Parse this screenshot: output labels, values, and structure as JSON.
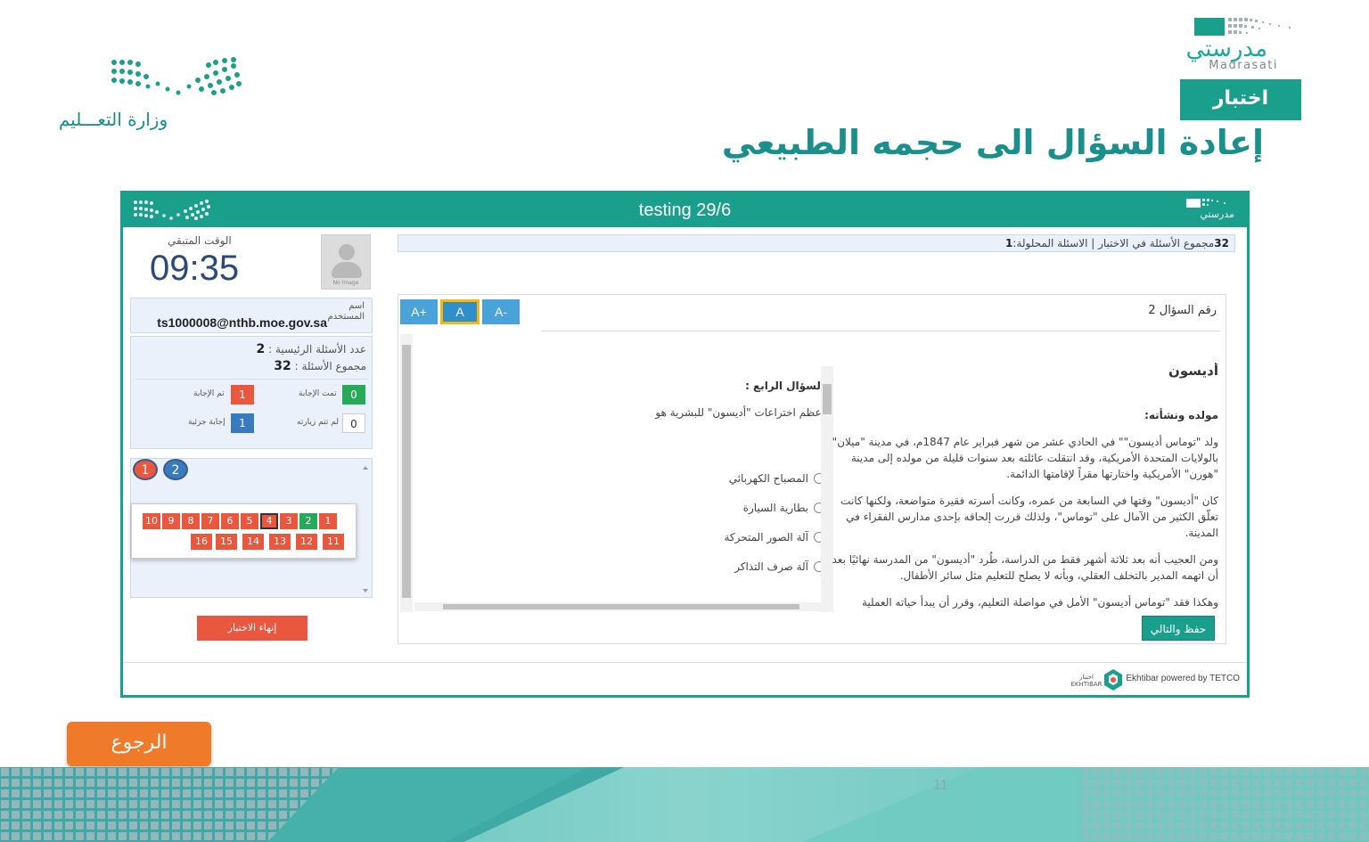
{
  "slide": {
    "moe_logo_text": "وزارة التعـــليم",
    "madrasati_ar": "مدرستي",
    "madrasati_en": "Madrasati",
    "exam_tag": "اختبار",
    "title": "إعادة السؤال الى حجمه الطبيعي",
    "back_button": "الرجوع",
    "page_number": "11"
  },
  "app": {
    "title": "testing 29/6",
    "header_logo_text": "مدرستي",
    "timer_label": "الوقت المتبقي",
    "timer": "09:35",
    "avatar_caption": "No Image",
    "user_label": "اسم المستخدم",
    "user_value": "ts1000008@nthb.moe.gov.sa",
    "main_questions_label": "عدد الأسئلة الرئيسية :",
    "main_questions_value": "2",
    "total_questions_label": "مجموع الأسئلة :",
    "total_questions_value": "32",
    "legend": {
      "completed_count": "0",
      "completed_label": "تمت الإجابة",
      "answered_count": "1",
      "answered_label": "تم الإجابة",
      "unvisited_count": "0",
      "unvisited_label": "لم تتم زيارته",
      "partial_count": "1",
      "partial_label": "إجابة جزئية"
    },
    "main_question_circles": [
      "1",
      "2"
    ],
    "sub_questions_row1": [
      "10",
      "9",
      "8",
      "7",
      "6",
      "5",
      "4",
      "3",
      "2",
      "1"
    ],
    "sub_questions_row2": [
      "16",
      "15",
      "14",
      "13",
      "12",
      "11"
    ],
    "end_exam_button": "إنهاء الاختبار",
    "summary_total": "32",
    "summary_text": "مجموع الأسئلة في الاختبار | الاسئلة المحلولة:",
    "summary_solved": "1",
    "font_buttons": {
      "increase": "A+",
      "normal": "A",
      "decrease": "A-"
    },
    "question_number": "رقم السؤال 2",
    "passage": {
      "title": "أديسون",
      "subtitle": "مولده ونشأته:",
      "p1": "ولد \"توماس أديسون\"\" في الحادي عشر من شهر فبراير عام 1847م، في مدينة \"ميلان\" بالولايات المتحدة الأمريكية، وقد انتقلت عائلته بعد سنوات قليلة من مولده إلى مدينة \"هورن\" الأمريكية واختارتها مقراً لإقامتها الدائمة.",
      "p2": "كان \"أديسون\" وقتها في السابعة من عمره، وكانت أسرته فقيرة متواضعة، ولكنها كانت تعلّق الكثير من الآمال على \"توماس\"، ولذلك قررت إلحاقه بإحدى مدارس الفقراء في المدينة.",
      "p3": "ومن العجيب أنه بعد ثلاثة أشهر فقط من الدراسة، طُرد \"أديسون\" من المدرسة نهائيًا بعد أن اتهمه المدير بالتخلف العقلي، وبأنه لا يصلح للتعليم مثل سائر الأطفال.",
      "p4": "وهكذا فقد \"توماس أديسون\" الأمل في مواصلة التعليم، وقرر أن يبدأ حياته العملية"
    },
    "question": {
      "heading": "السؤال الرابع :",
      "text": "أعظم اختراعات \"أديسون\" للبشرية هو",
      "options": [
        "المصباح الكهربائي",
        "بطارية السيارة",
        "آلة الصور المتحركة",
        "آلة صرف التذاكر"
      ]
    },
    "save_next_button": "حفظ والتالي",
    "powered_by": "Ekhtibar powered by TETCO",
    "ekhtibar_logo_text": "اختبار EKHTIBAR"
  },
  "colors": {
    "brand_teal": "#1a9f8c",
    "title_teal": "#1a8f8c",
    "orange": "#ef7a2a",
    "red_badge": "#e9573f",
    "green_badge": "#27a85a",
    "blue_badge": "#3a7bbf",
    "highlight": "#f3b911"
  },
  "icons": [
    "moe-dots-logo",
    "madrasati-logo",
    "avatar-icon",
    "radio-icon",
    "ekhtibar-logo"
  ]
}
